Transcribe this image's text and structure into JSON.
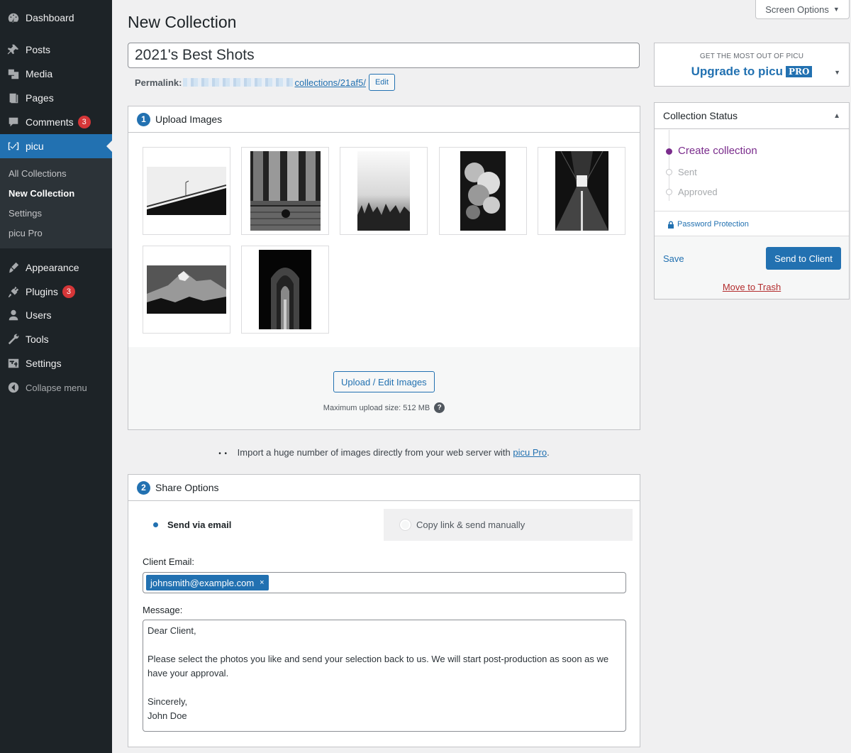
{
  "sidebar": {
    "items": [
      {
        "label": "Dashboard",
        "icon": "dashboard-icon"
      },
      {
        "label": "Posts",
        "icon": "pin-icon"
      },
      {
        "label": "Media",
        "icon": "media-icon"
      },
      {
        "label": "Pages",
        "icon": "pages-icon"
      },
      {
        "label": "Comments",
        "icon": "comments-icon",
        "badge": "3"
      },
      {
        "label": "picu",
        "icon": "picu-icon"
      },
      {
        "label": "Appearance",
        "icon": "brush-icon"
      },
      {
        "label": "Plugins",
        "icon": "plugin-icon",
        "badge": "3"
      },
      {
        "label": "Users",
        "icon": "users-icon"
      },
      {
        "label": "Tools",
        "icon": "wrench-icon"
      },
      {
        "label": "Settings",
        "icon": "settings-icon"
      },
      {
        "label": "Collapse menu",
        "icon": "collapse-icon"
      }
    ],
    "submenu": [
      "All Collections",
      "New Collection",
      "Settings",
      "picu Pro"
    ]
  },
  "header": {
    "screen_options": "Screen Options",
    "page_title": "New Collection"
  },
  "collection": {
    "title": "2021's Best Shots",
    "permalink_label": "Permalink:",
    "permalink_path": "collections/21af5/",
    "edit_label": "Edit"
  },
  "upload": {
    "step": "1",
    "heading": "Upload Images",
    "button": "Upload / Edit Images",
    "max_size": "Maximum upload size: 512 MB",
    "help_icon": "?",
    "thumbnails": [
      "bridge",
      "columns",
      "forest-fog",
      "clouds",
      "corridor",
      "mountain",
      "archway"
    ]
  },
  "import_note": {
    "icon": "• •",
    "text": "Import a huge number of images directly from your web server with",
    "link": "picu Pro",
    "end": "."
  },
  "share": {
    "step": "2",
    "heading": "Share Options",
    "tab_email": "Send via email",
    "tab_copy": "Copy link & send manually",
    "client_email_label": "Client Email:",
    "client_email": "johnsmith@example.com",
    "remove": "×",
    "message_label": "Message:",
    "message": "Dear Client,\n\nPlease select the photos you like and send your selection back to us. We will start post-production as soon as we have your approval.\n\nSincerely,\nJohn Doe"
  },
  "upgrade": {
    "small": "GET THE MOST OUT OF PICU",
    "big": "Upgrade to picu",
    "badge": "PRO"
  },
  "status": {
    "heading": "Collection Status",
    "steps": [
      {
        "label": "Create collection",
        "active": true
      },
      {
        "label": "Sent",
        "active": false
      },
      {
        "label": "Approved",
        "active": false
      }
    ],
    "password": "Password Protection",
    "save": "Save",
    "send": "Send to Client",
    "trash": "Move to Trash"
  },
  "colors": {
    "accent": "#2271b1",
    "sidebar_bg": "#1d2327",
    "active_step": "#7a2c8c",
    "danger": "#d63638"
  }
}
